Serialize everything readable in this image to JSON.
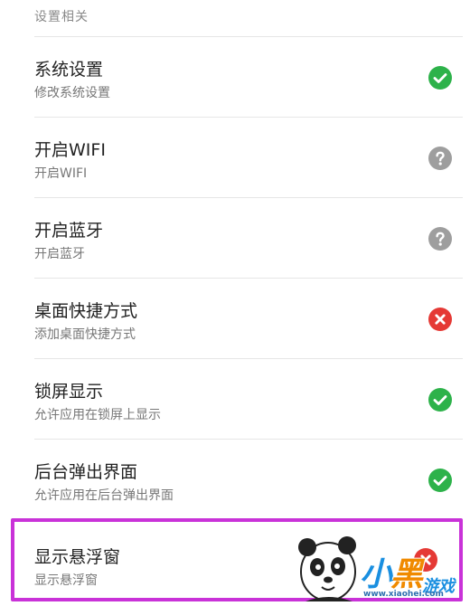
{
  "section": {
    "header": "设置相关"
  },
  "settings": [
    {
      "title": "系统设置",
      "subtitle": "修改系统设置",
      "status": "allowed"
    },
    {
      "title": "开启WIFI",
      "subtitle": "开启WIFI",
      "status": "unknown"
    },
    {
      "title": "开启蓝牙",
      "subtitle": "开启蓝牙",
      "status": "unknown"
    },
    {
      "title": "桌面快捷方式",
      "subtitle": "添加桌面快捷方式",
      "status": "denied"
    },
    {
      "title": "锁屏显示",
      "subtitle": "允许应用在锁屏上显示",
      "status": "allowed"
    },
    {
      "title": "后台弹出界面",
      "subtitle": "允许应用在后台弹出界面",
      "status": "allowed"
    }
  ],
  "highlighted": {
    "title": "显示悬浮窗",
    "subtitle": "显示悬浮窗",
    "status": "denied"
  },
  "watermark": {
    "brand_part1": "小",
    "brand_part2": "黑",
    "brand_part3": "游戏",
    "domain": "www.xiaohei.com"
  },
  "colors": {
    "allowed": "#2db24a",
    "unknown": "#9e9e9e",
    "denied": "#e53935",
    "highlight_border": "#c932d8"
  },
  "icons": {
    "allowed": "check-circle-icon",
    "unknown": "question-circle-icon",
    "denied": "x-circle-icon"
  }
}
